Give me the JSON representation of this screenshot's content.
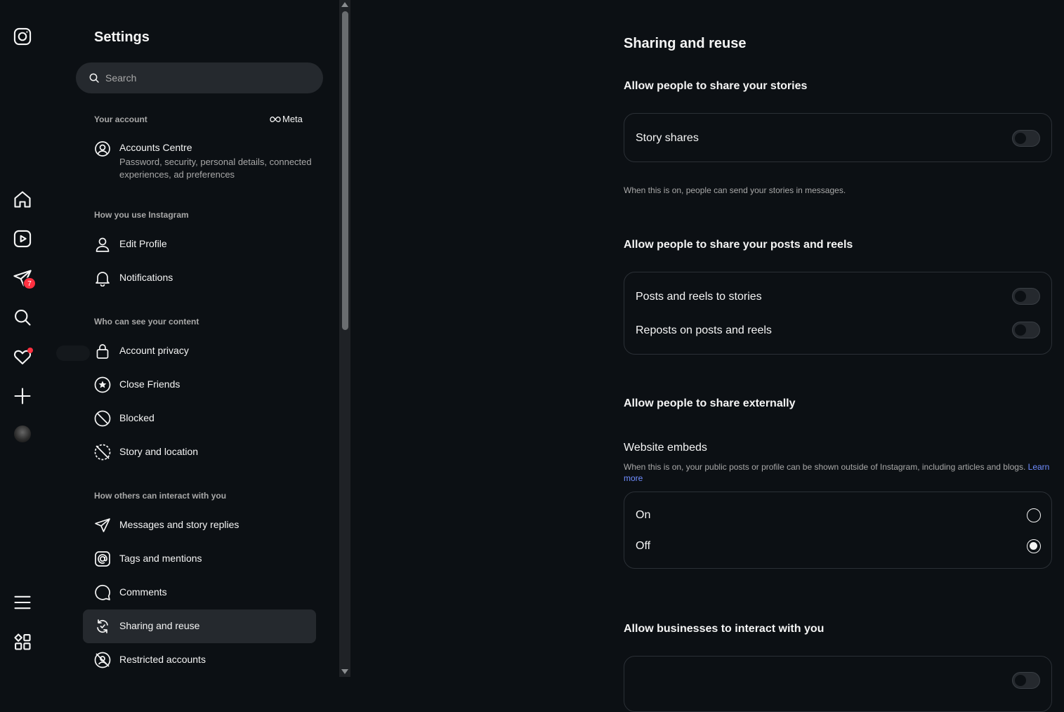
{
  "rail": {
    "icons": [
      "instagram-logo-icon",
      "home-icon",
      "reels-icon",
      "messages-icon",
      "search-icon",
      "heart-icon",
      "create-icon",
      "avatar",
      "menu-icon",
      "more-apps-icon"
    ],
    "messages_badge": "7"
  },
  "settings": {
    "title": "Settings",
    "search_placeholder": "Search",
    "your_account_label": "Your account",
    "meta_label": "Meta",
    "accounts_centre": {
      "title": "Accounts Centre",
      "subtitle": "Password, security, personal details, connected experiences, ad preferences"
    },
    "sections": [
      {
        "label": "How you use Instagram",
        "items": [
          "Edit Profile",
          "Notifications"
        ]
      },
      {
        "label": "Who can see your content",
        "items": [
          "Account privacy",
          "Close Friends",
          "Blocked",
          "Story and location"
        ]
      },
      {
        "label": "How others can interact with you",
        "items": [
          "Messages and story replies",
          "Tags and mentions",
          "Comments",
          "Sharing and reuse",
          "Restricted accounts"
        ]
      }
    ],
    "active_item": "Sharing and reuse"
  },
  "main": {
    "title": "Sharing and reuse",
    "stories": {
      "heading": "Allow people to share your stories",
      "rows": [
        {
          "label": "Story shares",
          "on": false
        }
      ],
      "help": "When this is on, people can send your stories in messages."
    },
    "posts": {
      "heading": "Allow people to share your posts and reels",
      "rows": [
        {
          "label": "Posts and reels to stories",
          "on": false
        },
        {
          "label": "Reposts on posts and reels",
          "on": false
        }
      ]
    },
    "external": {
      "heading": "Allow people to share externally",
      "subheading": "Website embeds",
      "help": "When this is on, your public posts or profile can be shown outside of Instagram, including articles and blogs.",
      "learn_more": "Learn more",
      "options": [
        {
          "label": "On",
          "selected": false
        },
        {
          "label": "Off",
          "selected": true
        }
      ]
    },
    "businesses": {
      "heading": "Allow businesses to interact with you"
    }
  },
  "colors": {
    "background": "#0c1014",
    "surface": "#25292e",
    "text": "#f5f5f5",
    "muted": "#a8a8a8",
    "badge": "#ff3040",
    "link": "#708dff"
  }
}
